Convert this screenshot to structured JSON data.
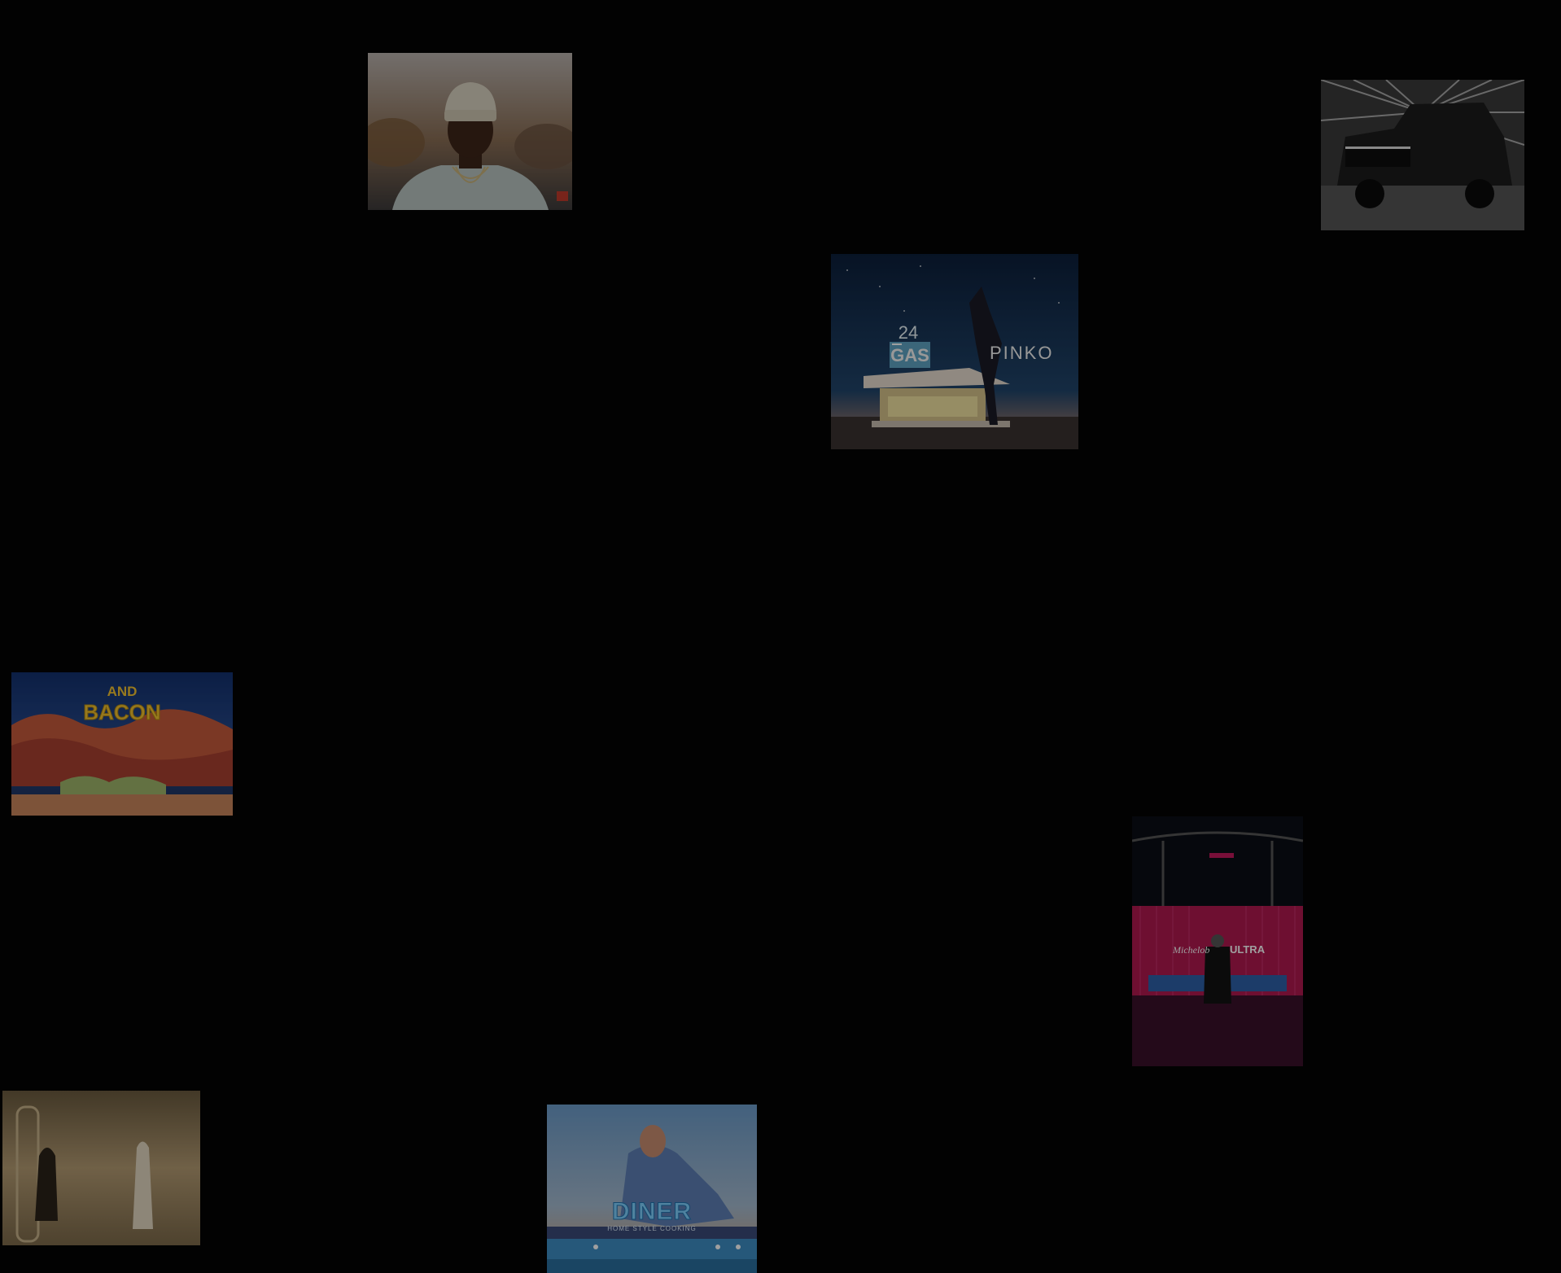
{
  "tiles": {
    "pinko": {
      "brand_text": "PINKO",
      "sign_number": "24",
      "sign_word": "GAS"
    },
    "bacon": {
      "line1": "AND",
      "line2": "BACON"
    },
    "ultra": {
      "script_text": "Michelob",
      "word_text": "ULTRA"
    },
    "diner": {
      "sign_text": "DINER",
      "sub_text": "HOME STYLE COOKING"
    }
  },
  "colors": {
    "background": "#020202",
    "neon_pink": "#c2185b",
    "neon_yellow": "#f2c230",
    "night_sky": "#0f2a4a"
  }
}
